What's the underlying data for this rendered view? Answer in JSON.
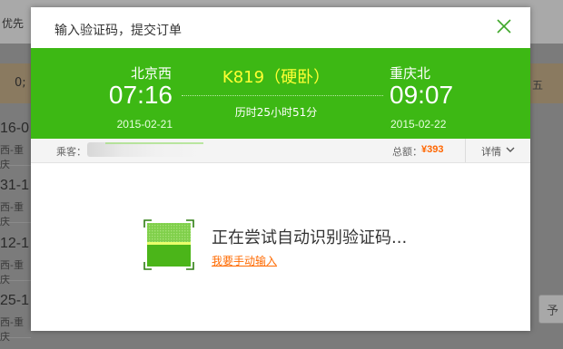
{
  "background": {
    "topbar_text": "优先",
    "strip_cell": "0;",
    "strip_right": "五",
    "rows": [
      {
        "time": "16-0",
        "route": "西-重庆"
      },
      {
        "time": "31-1",
        "route": "西-重庆"
      },
      {
        "time": "12-1",
        "route": "西-重庆"
      },
      {
        "time": "25-1",
        "route": "西-重庆"
      }
    ],
    "right_button": "予"
  },
  "modal": {
    "title": "输入验证码，提交订单"
  },
  "train": {
    "code": "K819（硬卧）",
    "from": {
      "station": "北京西",
      "time": "07:16",
      "date": "2015-02-21"
    },
    "to": {
      "station": "重庆北",
      "time": "09:07",
      "date": "2015-02-22"
    },
    "duration": "历时25小时51分"
  },
  "order": {
    "passenger_label": "乘客：",
    "total_label": "总额：",
    "total_value": "¥393",
    "details_label": "详情"
  },
  "captcha": {
    "status_text": "正在尝试自动识别验证码...",
    "manual_link": "我要手动输入"
  },
  "colors": {
    "green_bar": "#3db814",
    "train_code": "#ffff33",
    "price": "#ff6600",
    "link": "#ff6a00"
  }
}
